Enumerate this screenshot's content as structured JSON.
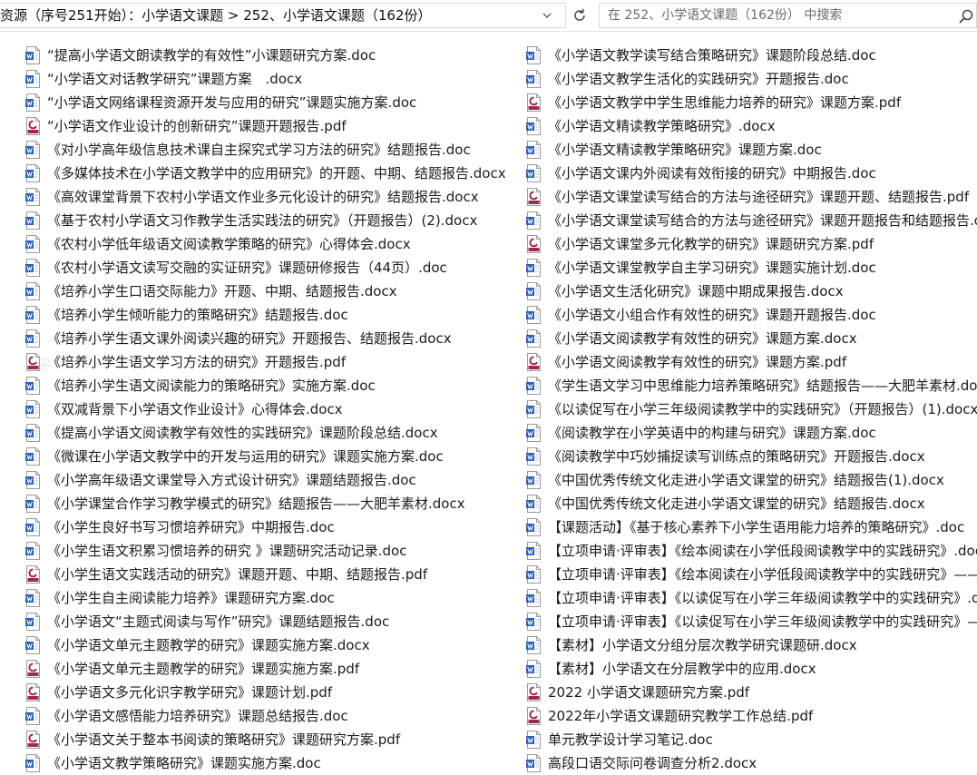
{
  "address_bar": {
    "path": "资源（序号251开始）：小学语文课题 > 252、小学语文课题（162份）"
  },
  "search": {
    "placeholder": "在 252、小学语文课题（162份） 中搜索"
  },
  "files_left": [
    {
      "name": "“提高小学语文朗读教学的有效性”小课题研究方案.doc",
      "type": "word"
    },
    {
      "name": "“小学语文对话教学研究”课题方案　.docx",
      "type": "word"
    },
    {
      "name": "“小学语文网络课程资源开发与应用的研究”课题实施方案.doc",
      "type": "word"
    },
    {
      "name": "“小学语文作业设计的创新研究”课题开题报告.pdf",
      "type": "pdf"
    },
    {
      "name": "《对小学高年级信息技术课自主探究式学习方法的研究》结题报告.doc",
      "type": "word"
    },
    {
      "name": "《多媒体技术在小学语文教学中的应用研究》的开题、中期、结题报告.docx",
      "type": "word"
    },
    {
      "name": "《高效课堂背景下农村小学语文作业多元化设计的研究》结题报告.docx",
      "type": "word"
    },
    {
      "name": "《基于农村小学语文习作教学生活实践法的研究》（开题报告）(2).docx",
      "type": "word"
    },
    {
      "name": "《农村小学低年级语文阅读教学策略的研究》心得体会.docx",
      "type": "word"
    },
    {
      "name": "《农村小学语文读写交融的实证研究》课题研修报告（44页）.doc",
      "type": "word"
    },
    {
      "name": "《培养小学生口语交际能力》开题、中期、结题报告.docx",
      "type": "word"
    },
    {
      "name": "《培养小学生倾听能力的策略研究》结题报告.doc",
      "type": "word"
    },
    {
      "name": "《培养小学生语文课外阅读兴趣的研究》开题报告、结题报告.docx",
      "type": "word"
    },
    {
      "name": "《培养小学生语文学习方法的研究》开题报告.pdf",
      "type": "pdf"
    },
    {
      "name": "《培养小学生语文阅读能力的策略研究》实施方案.doc",
      "type": "word"
    },
    {
      "name": "《双减背景下小学语文作业设计》心得体会.docx",
      "type": "word"
    },
    {
      "name": "《提高小学语文阅读教学有效性的实践研究》课题阶段总结.docx",
      "type": "word"
    },
    {
      "name": "《微课在小学语文教学中的开发与运用的研究》课题实施方案.doc",
      "type": "word"
    },
    {
      "name": "《小学高年级语文课堂导入方式设计研究》课题结题报告.doc",
      "type": "word"
    },
    {
      "name": "《小学课堂合作学习教学模式的研究》结题报告——大肥羊素材.docx",
      "type": "word"
    },
    {
      "name": "《小学生良好书写习惯培养研究》中期报告.doc",
      "type": "word"
    },
    {
      "name": "《小学生语文积累习惯培养的研究 》课题研究活动记录.doc",
      "type": "word"
    },
    {
      "name": "《小学生语文实践活动的研究》课题开题、中期、结题报告.pdf",
      "type": "pdf"
    },
    {
      "name": "《小学生自主阅读能力培养》课题研究方案.doc",
      "type": "word"
    },
    {
      "name": "《小学语文“主题式阅读与写作”研究》课题结题报告.doc",
      "type": "word"
    },
    {
      "name": "《小学语文单元主题教学的研究》课题实施方案.docx",
      "type": "word"
    },
    {
      "name": "《小学语文单元主题教学的研究》课题实施方案.pdf",
      "type": "pdf"
    },
    {
      "name": "《小学语文多元化识字教学研究》课题计划.pdf",
      "type": "pdf"
    },
    {
      "name": "《小学语文感悟能力培养研究》课题总结报告.doc",
      "type": "word"
    },
    {
      "name": "《小学语文关于整本书阅读的策略研究》课题研究方案.pdf",
      "type": "pdf"
    },
    {
      "name": "《小学语文教学策略研究》课题实施方案.doc",
      "type": "word"
    }
  ],
  "files_right": [
    {
      "name": "《小学语文教学读写结合策略研究》课题阶段总结.doc",
      "type": "word"
    },
    {
      "name": "《小学语文教学生活化的实践研究》开题报告.doc",
      "type": "word"
    },
    {
      "name": "《小学语文教学中学生思维能力培养的研究》课题方案.pdf",
      "type": "pdf"
    },
    {
      "name": "《小学语文精读教学策略研究》.docx",
      "type": "word"
    },
    {
      "name": "《小学语文精读教学策略研究》课题方案.doc",
      "type": "word"
    },
    {
      "name": "《小学语文课内外阅读有效衔接的研究》中期报告.doc",
      "type": "word"
    },
    {
      "name": "《小学语文课堂读写结合的方法与途径研究》课题开题、结题报告.pdf",
      "type": "pdf"
    },
    {
      "name": "《小学语文课堂读写结合的方法与途径研究》课题开题报告和结题报告.docx",
      "type": "word"
    },
    {
      "name": "《小学语文课堂多元化教学的研究》课题研究方案.pdf",
      "type": "pdf"
    },
    {
      "name": "《小学语文课堂教学自主学习研究》课题实施计划.doc",
      "type": "word"
    },
    {
      "name": "《小学语文生活化研究》课题中期成果报告.docx",
      "type": "word"
    },
    {
      "name": "《小学语文小组合作有效性的研究》课题开题报告.doc",
      "type": "word"
    },
    {
      "name": "《小学语文阅读教学有效性的研究》课题方案.docx",
      "type": "word"
    },
    {
      "name": "《小学语文阅读教学有效性的研究》课题方案.pdf",
      "type": "pdf"
    },
    {
      "name": "《学生语文学习中思维能力培养策略研究》结题报告——大肥羊素材.doc",
      "type": "word"
    },
    {
      "name": "《以读促写在小学三年级阅读教学中的实践研究》（开题报告）(1).docx",
      "type": "word"
    },
    {
      "name": "《阅读教学在小学英语中的构建与研究》课题方案.doc",
      "type": "word"
    },
    {
      "name": "《阅读教学中巧妙捕捉读写训练点的策略研究》开题报告.docx",
      "type": "word"
    },
    {
      "name": "《中国优秀传统文化走进小学语文课堂的研究》结题报告(1).docx",
      "type": "word"
    },
    {
      "name": "《中国优秀传统文化走进小学语文课堂的研究》结题报告.docx",
      "type": "word"
    },
    {
      "name": "【课题活动】《基于核心素养下小学生语用能力培养的策略研究》.doc",
      "type": "word"
    },
    {
      "name": "【立项申请·评审表】《绘本阅读在小学低段阅读教学中的实践研究》.doc",
      "type": "word"
    },
    {
      "name": "【立项申请·评审表】《绘本阅读在小学低段阅读教学中的实践研究》——",
      "type": "word"
    },
    {
      "name": "【立项申请·评审表】《以读促写在小学三年级阅读教学中的实践研究》.doc",
      "type": "word"
    },
    {
      "name": "【立项申请·评审表】《以读促写在小学三年级阅读教学中的实践研究》——",
      "type": "word"
    },
    {
      "name": "【素材】小学语文分组分层次教学研究课题研.docx",
      "type": "word"
    },
    {
      "name": "【素材】小学语文在分层教学中的应用.docx",
      "type": "word"
    },
    {
      "name": "2022 小学语文课题研究方案.pdf",
      "type": "pdf"
    },
    {
      "name": "2022年小学语文课题研究教学工作总结.pdf",
      "type": "pdf"
    },
    {
      "name": "单元教学设计学习笔记.doc",
      "type": "word"
    },
    {
      "name": "高段口语交际问卷调查分析2.docx",
      "type": "word"
    }
  ],
  "colors": {
    "word_icon": "#2b5fb4",
    "pdf_icon": "#9c2b4e",
    "border": "#d9d9d9",
    "placeholder": "#6b6b6b"
  },
  "icons": {
    "word_file": "word-doc-icon",
    "pdf_file": "pdf-file-icon",
    "refresh": "refresh-icon",
    "search": "search-icon",
    "dropdown": "chevron-down-icon"
  }
}
